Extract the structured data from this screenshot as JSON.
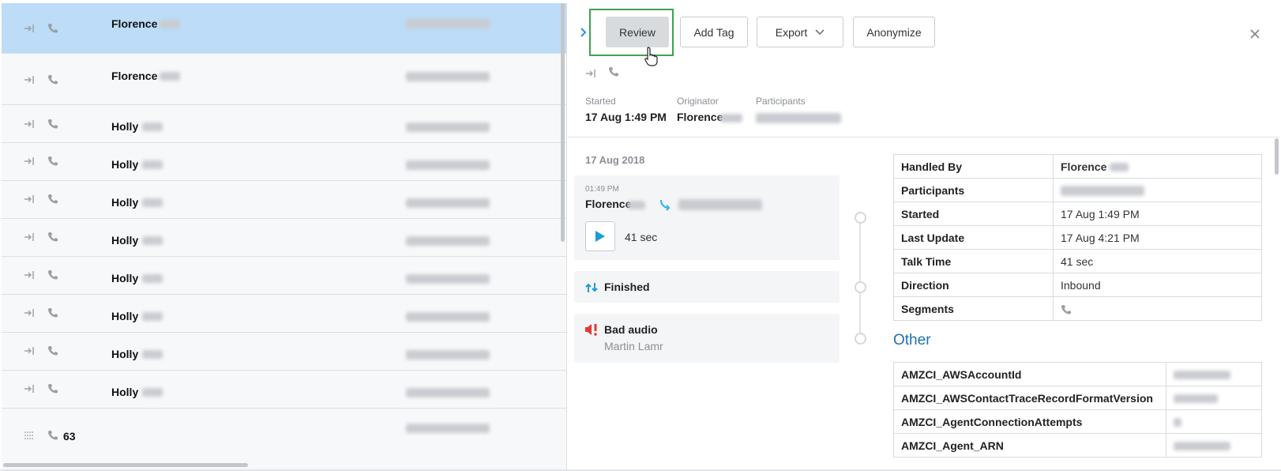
{
  "list": {
    "rows": [
      {
        "name": "Florence",
        "selected": true
      },
      {
        "name": "Florence",
        "selected": false
      },
      {
        "name": "Holly",
        "selected": false
      },
      {
        "name": "Holly",
        "selected": false
      },
      {
        "name": "Holly",
        "selected": false
      },
      {
        "name": "Holly",
        "selected": false
      },
      {
        "name": "Holly",
        "selected": false
      },
      {
        "name": "Holly",
        "selected": false
      },
      {
        "name": "Holly",
        "selected": false
      },
      {
        "name": "Holly",
        "selected": false
      }
    ],
    "summary_count": "63"
  },
  "toolbar": {
    "review_label": "Review",
    "add_tag_label": "Add Tag",
    "export_label": "Export",
    "anonymize_label": "Anonymize"
  },
  "meta": {
    "started_label": "Started",
    "started_value": "17 Aug 1:49 PM",
    "originator_label": "Originator",
    "originator_value": "Florence",
    "participants_label": "Participants"
  },
  "timeline": {
    "date": "17 Aug 2018",
    "call": {
      "time": "01:49 PM",
      "from": "Florence",
      "duration": "41 sec"
    },
    "finished_label": "Finished",
    "issue": {
      "title": "Bad audio",
      "author": "Martin Lamr"
    }
  },
  "details": {
    "rows": [
      {
        "key": "Handled By",
        "value": "Florence"
      },
      {
        "key": "Participants",
        "value": ""
      },
      {
        "key": "Started",
        "value": "17 Aug 1:49 PM"
      },
      {
        "key": "Last Update",
        "value": "17 Aug 4:21 PM"
      },
      {
        "key": "Talk Time",
        "value": "41 sec"
      },
      {
        "key": "Direction",
        "value": "Inbound"
      },
      {
        "key": "Segments",
        "value": ""
      }
    ]
  },
  "other": {
    "title": "Other",
    "rows": [
      {
        "key": "AMZCI_AWSAccountId"
      },
      {
        "key": "AMZCI_AWSContactTraceRecordFormatVersion"
      },
      {
        "key": "AMZCI_AgentConnectionAttempts"
      },
      {
        "key": "AMZCI_Agent_ARN"
      }
    ]
  },
  "colors": {
    "accent": "#1f6fb2",
    "selected_row": "#bcdcf8",
    "highlight": "#3fa34d",
    "alert": "#e53935",
    "play": "#1e9bd7"
  },
  "icons": [
    "inbound-arrow-icon",
    "phone-icon",
    "chevron-right-icon",
    "close-icon",
    "chevron-down-icon",
    "play-icon",
    "transfer-icon",
    "finished-icon",
    "alert-icon",
    "list-icon",
    "cursor-hand-icon"
  ]
}
